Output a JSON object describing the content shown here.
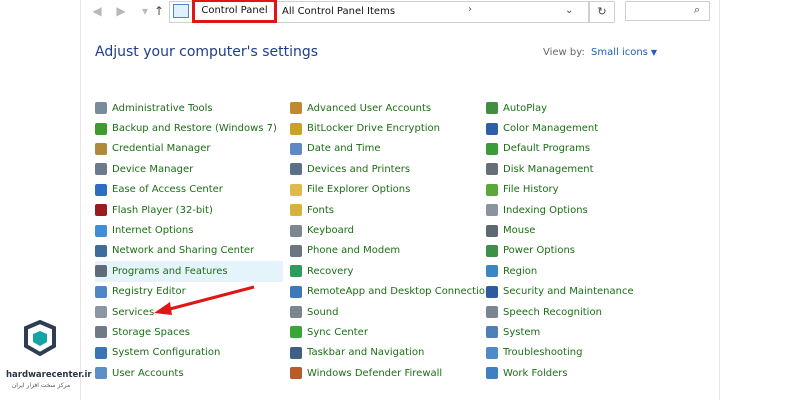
{
  "address": {
    "crumb1": "Control Panel",
    "crumb2": "All Control Panel Items",
    "search_placeholder": ""
  },
  "header": {
    "title": "Adjust your computer's settings",
    "view_by_label": "View by:",
    "view_by_value": "Small icons"
  },
  "items": {
    "col1": [
      {
        "label": "Administrative Tools",
        "icon": "tools-icon",
        "color": "#7a8b99"
      },
      {
        "label": "Backup and Restore (Windows 7)",
        "icon": "backup-icon",
        "color": "#3e9b2e"
      },
      {
        "label": "Credential Manager",
        "icon": "credential-icon",
        "color": "#b08a3a"
      },
      {
        "label": "Device Manager",
        "icon": "device-manager-icon",
        "color": "#6b7b8c"
      },
      {
        "label": "Ease of Access Center",
        "icon": "ease-of-access-icon",
        "color": "#2c6fc2"
      },
      {
        "label": "Flash Player (32-bit)",
        "icon": "flash-icon",
        "color": "#9b1c1c"
      },
      {
        "label": "Internet Options",
        "icon": "internet-icon",
        "color": "#3e8fd8"
      },
      {
        "label": "Network and Sharing Center",
        "icon": "network-icon",
        "color": "#3d6c9e"
      },
      {
        "label": "Programs and Features",
        "icon": "programs-icon",
        "color": "#5f6b78"
      },
      {
        "label": "Registry Editor",
        "icon": "registry-icon",
        "color": "#4f86c6"
      },
      {
        "label": "Services",
        "icon": "services-icon",
        "color": "#8a96a3"
      },
      {
        "label": "Storage Spaces",
        "icon": "storage-icon",
        "color": "#6f7a86"
      },
      {
        "label": "System Configuration",
        "icon": "sysconfig-icon",
        "color": "#3a75b8"
      },
      {
        "label": "User Accounts",
        "icon": "user-accounts-icon",
        "color": "#5a8fc8"
      }
    ],
    "col2": [
      {
        "label": "Advanced User Accounts",
        "icon": "adv-users-icon",
        "color": "#c0882f"
      },
      {
        "label": "BitLocker Drive Encryption",
        "icon": "bitlocker-icon",
        "color": "#c9a227"
      },
      {
        "label": "Date and Time",
        "icon": "clock-icon",
        "color": "#5d8ac2"
      },
      {
        "label": "Devices and Printers",
        "icon": "printer-icon",
        "color": "#5b6f86"
      },
      {
        "label": "File Explorer Options",
        "icon": "folder-options-icon",
        "color": "#e1b84a"
      },
      {
        "label": "Fonts",
        "icon": "fonts-icon",
        "color": "#d8b23f"
      },
      {
        "label": "Keyboard",
        "icon": "keyboard-icon",
        "color": "#7d8791"
      },
      {
        "label": "Phone and Modem",
        "icon": "phone-icon",
        "color": "#6b7682"
      },
      {
        "label": "Recovery",
        "icon": "recovery-icon",
        "color": "#2f9a5e"
      },
      {
        "label": "RemoteApp and Desktop Connections",
        "icon": "remoteapp-icon",
        "color": "#3f78b8"
      },
      {
        "label": "Sound",
        "icon": "sound-icon",
        "color": "#7a8590"
      },
      {
        "label": "Sync Center",
        "icon": "sync-icon",
        "color": "#3aa63a"
      },
      {
        "label": "Taskbar and Navigation",
        "icon": "taskbar-icon",
        "color": "#3f5f86"
      },
      {
        "label": "Windows Defender Firewall",
        "icon": "firewall-icon",
        "color": "#b85a2a"
      }
    ],
    "col3": [
      {
        "label": "AutoPlay",
        "icon": "autoplay-icon",
        "color": "#3f8f3f"
      },
      {
        "label": "Color Management",
        "icon": "color-mgmt-icon",
        "color": "#2e5fa8"
      },
      {
        "label": "Default Programs",
        "icon": "default-programs-icon",
        "color": "#3a9b3a"
      },
      {
        "label": "Disk Management",
        "icon": "disk-icon",
        "color": "#666f78"
      },
      {
        "label": "File History",
        "icon": "file-history-icon",
        "color": "#5aa83a"
      },
      {
        "label": "Indexing Options",
        "icon": "indexing-icon",
        "color": "#8a949e"
      },
      {
        "label": "Mouse",
        "icon": "mouse-icon",
        "color": "#5d6873"
      },
      {
        "label": "Power Options",
        "icon": "power-icon",
        "color": "#3d8f4a"
      },
      {
        "label": "Region",
        "icon": "region-icon",
        "color": "#3d86c4"
      },
      {
        "label": "Security and Maintenance",
        "icon": "flag-icon",
        "color": "#2d5aa0"
      },
      {
        "label": "Speech Recognition",
        "icon": "microphone-icon",
        "color": "#7a8590"
      },
      {
        "label": "System",
        "icon": "system-icon",
        "color": "#4f7fb8"
      },
      {
        "label": "Troubleshooting",
        "icon": "troubleshoot-icon",
        "color": "#4f8bc6"
      },
      {
        "label": "Work Folders",
        "icon": "work-folders-icon",
        "color": "#3f7fc2"
      }
    ]
  },
  "highlight_index": 8,
  "watermark": {
    "site": "hardwarecenter.ir",
    "tagline": "مرکز سخت افزار ایران"
  }
}
